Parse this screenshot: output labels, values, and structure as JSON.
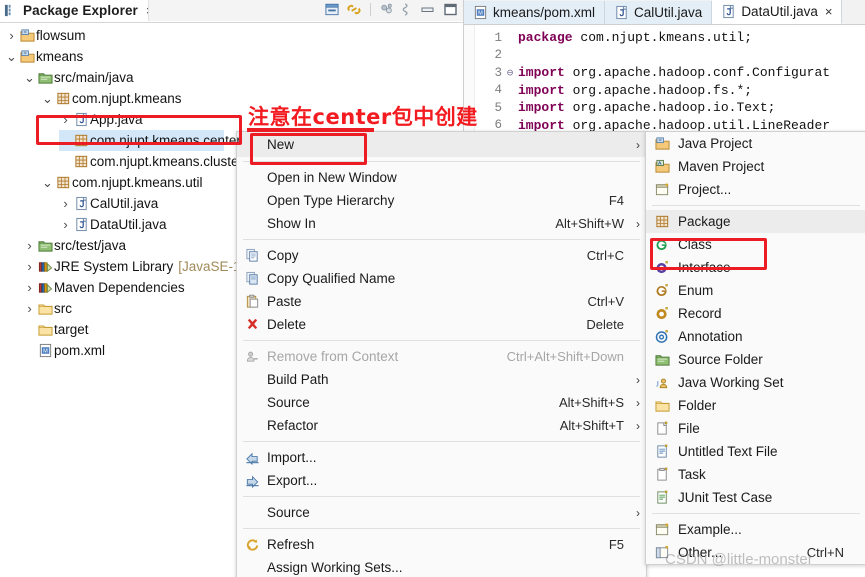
{
  "package_explorer": {
    "tab_title": "Package Explorer",
    "close_label": "×",
    "toolbar": [
      {
        "name": "collapse-all-icon",
        "title": "Collapse All"
      },
      {
        "name": "link-with-editor-icon",
        "title": "Link with Editor"
      },
      {
        "name": "view-menu-icon",
        "title": "View Menu"
      },
      {
        "name": "focus-on-active-task-icon",
        "title": "Focus on Active Task"
      },
      {
        "name": "minimize-icon",
        "title": "Minimize"
      },
      {
        "name": "maximize-icon",
        "title": "Maximize"
      }
    ],
    "tree": [
      {
        "label": "flowsum",
        "indent": 0,
        "twisty": "›",
        "icon": "java-project-icon",
        "selected": false
      },
      {
        "label": "kmeans",
        "indent": 0,
        "twisty": "⌄",
        "icon": "java-project-icon",
        "selected": false
      },
      {
        "label": "src/main/java",
        "indent": 1,
        "twisty": "⌄",
        "icon": "source-folder-icon",
        "selected": false
      },
      {
        "label": "com.njupt.kmeans",
        "indent": 2,
        "twisty": "⌄",
        "icon": "package-icon",
        "selected": false
      },
      {
        "label": "App.java",
        "indent": 3,
        "twisty": "›",
        "icon": "java-file-icon",
        "selected": false
      },
      {
        "label": "com.njupt.kmeans.center",
        "indent": 3,
        "twisty": "",
        "icon": "package-icon",
        "selected": true
      },
      {
        "label": "com.njupt.kmeans.cluster",
        "indent": 3,
        "twisty": "",
        "icon": "package-icon",
        "selected": false
      },
      {
        "label": "com.njupt.kmeans.util",
        "indent": 2,
        "twisty": "⌄",
        "icon": "package-icon",
        "selected": false
      },
      {
        "label": "CalUtil.java",
        "indent": 3,
        "twisty": "›",
        "icon": "java-file-icon",
        "selected": false
      },
      {
        "label": "DataUtil.java",
        "indent": 3,
        "twisty": "›",
        "icon": "java-file-icon",
        "selected": false
      },
      {
        "label": "src/test/java",
        "indent": 1,
        "twisty": "›",
        "icon": "source-folder-icon",
        "selected": false
      },
      {
        "label": "JRE System Library",
        "suffix": "[JavaSE-1",
        "indent": 1,
        "twisty": "›",
        "icon": "library-icon",
        "selected": false
      },
      {
        "label": "Maven Dependencies",
        "indent": 1,
        "twisty": "›",
        "icon": "library-icon",
        "selected": false
      },
      {
        "label": "src",
        "indent": 1,
        "twisty": "›",
        "icon": "folder-icon",
        "selected": false
      },
      {
        "label": "target",
        "indent": 1,
        "twisty": "",
        "icon": "folder-icon",
        "selected": false
      },
      {
        "label": "pom.xml",
        "indent": 1,
        "twisty": "",
        "icon": "xml-file-icon",
        "selected": false
      }
    ]
  },
  "editor": {
    "tabs": [
      {
        "label": "kmeans/pom.xml",
        "icon": "xml-file-icon",
        "active": false,
        "closable": false
      },
      {
        "label": "CalUtil.java",
        "icon": "java-file-icon",
        "active": false,
        "closable": false
      },
      {
        "label": "DataUtil.java",
        "icon": "java-file-icon",
        "active": true,
        "closable": true
      }
    ],
    "close_label": "×",
    "lines": [
      {
        "num": "1",
        "fold": "",
        "keyword": "package",
        "rest": " com.njupt.kmeans.util;"
      },
      {
        "num": "2",
        "fold": "",
        "keyword": "",
        "rest": ""
      },
      {
        "num": "3",
        "fold": "⊖",
        "keyword": "import",
        "rest": " org.apache.hadoop.conf.Configurat"
      },
      {
        "num": "4",
        "fold": "",
        "keyword": "import",
        "rest": " org.apache.hadoop.fs.*;"
      },
      {
        "num": "5",
        "fold": "",
        "keyword": "import",
        "rest": " org.apache.hadoop.io.Text;"
      },
      {
        "num": "6",
        "fold": "",
        "keyword": "import",
        "rest": " org.apache.hadoop.util.LineReader"
      }
    ]
  },
  "context_menu": {
    "items": [
      {
        "type": "item",
        "label": "New",
        "accel": "",
        "arrow": "›",
        "icon": "",
        "highlighted": true,
        "disabled": false
      },
      {
        "type": "separator"
      },
      {
        "type": "item",
        "label": "Open in New Window",
        "accel": "",
        "arrow": "",
        "icon": "",
        "highlighted": false,
        "disabled": false
      },
      {
        "type": "item",
        "label": "Open Type Hierarchy",
        "accel": "F4",
        "arrow": "",
        "icon": "",
        "highlighted": false,
        "disabled": false
      },
      {
        "type": "item",
        "label": "Show In",
        "accel": "Alt+Shift+W",
        "arrow": "›",
        "icon": "",
        "highlighted": false,
        "disabled": false
      },
      {
        "type": "separator"
      },
      {
        "type": "item",
        "label": "Copy",
        "accel": "Ctrl+C",
        "arrow": "",
        "icon": "copy-icon",
        "highlighted": false,
        "disabled": false
      },
      {
        "type": "item",
        "label": "Copy Qualified Name",
        "accel": "",
        "arrow": "",
        "icon": "copy-qualified-name-icon",
        "highlighted": false,
        "disabled": false
      },
      {
        "type": "item",
        "label": "Paste",
        "accel": "Ctrl+V",
        "arrow": "",
        "icon": "paste-icon",
        "highlighted": false,
        "disabled": false
      },
      {
        "type": "item",
        "label": "Delete",
        "accel": "Delete",
        "arrow": "",
        "icon": "delete-icon",
        "highlighted": false,
        "disabled": false
      },
      {
        "type": "separator"
      },
      {
        "type": "item",
        "label": "Remove from Context",
        "accel": "Ctrl+Alt+Shift+Down",
        "arrow": "",
        "icon": "remove-from-context-icon",
        "highlighted": false,
        "disabled": true
      },
      {
        "type": "item",
        "label": "Build Path",
        "accel": "",
        "arrow": "›",
        "icon": "",
        "highlighted": false,
        "disabled": false
      },
      {
        "type": "item",
        "label": "Source",
        "accel": "Alt+Shift+S",
        "arrow": "›",
        "icon": "",
        "highlighted": false,
        "disabled": false
      },
      {
        "type": "item",
        "label": "Refactor",
        "accel": "Alt+Shift+T",
        "arrow": "›",
        "icon": "",
        "highlighted": false,
        "disabled": false
      },
      {
        "type": "separator"
      },
      {
        "type": "item",
        "label": "Import...",
        "accel": "",
        "arrow": "",
        "icon": "import-icon",
        "highlighted": false,
        "disabled": false
      },
      {
        "type": "item",
        "label": "Export...",
        "accel": "",
        "arrow": "",
        "icon": "export-icon",
        "highlighted": false,
        "disabled": false
      },
      {
        "type": "separator"
      },
      {
        "type": "item",
        "label": "Source",
        "accel": "",
        "arrow": "›",
        "icon": "",
        "highlighted": false,
        "disabled": false
      },
      {
        "type": "separator"
      },
      {
        "type": "item",
        "label": "Refresh",
        "accel": "F5",
        "arrow": "",
        "icon": "refresh-icon",
        "highlighted": false,
        "disabled": false
      },
      {
        "type": "item",
        "label": "Assign Working Sets...",
        "accel": "",
        "arrow": "",
        "icon": "",
        "highlighted": false,
        "disabled": false
      }
    ]
  },
  "new_submenu": {
    "items": [
      {
        "type": "item",
        "label": "Java Project",
        "accel": "",
        "icon": "java-project-icon",
        "highlighted": false
      },
      {
        "type": "item",
        "label": "Maven Project",
        "accel": "",
        "icon": "maven-project-icon",
        "highlighted": false
      },
      {
        "type": "item",
        "label": "Project...",
        "accel": "",
        "icon": "project-icon",
        "highlighted": false
      },
      {
        "type": "separator"
      },
      {
        "type": "item",
        "label": "Package",
        "accel": "",
        "icon": "package-icon",
        "highlighted": true
      },
      {
        "type": "item",
        "label": "Class",
        "accel": "",
        "icon": "class-icon",
        "highlighted": false
      },
      {
        "type": "item",
        "label": "Interface",
        "accel": "",
        "icon": "interface-icon",
        "highlighted": false
      },
      {
        "type": "item",
        "label": "Enum",
        "accel": "",
        "icon": "enum-icon",
        "highlighted": false
      },
      {
        "type": "item",
        "label": "Record",
        "accel": "",
        "icon": "record-icon",
        "highlighted": false
      },
      {
        "type": "item",
        "label": "Annotation",
        "accel": "",
        "icon": "annotation-icon",
        "highlighted": false
      },
      {
        "type": "item",
        "label": "Source Folder",
        "accel": "",
        "icon": "source-folder-icon",
        "highlighted": false
      },
      {
        "type": "item",
        "label": "Java Working Set",
        "accel": "",
        "icon": "java-working-set-icon",
        "highlighted": false
      },
      {
        "type": "item",
        "label": "Folder",
        "accel": "",
        "icon": "folder-icon",
        "highlighted": false
      },
      {
        "type": "item",
        "label": "File",
        "accel": "",
        "icon": "file-icon",
        "highlighted": false
      },
      {
        "type": "item",
        "label": "Untitled Text File",
        "accel": "",
        "icon": "text-file-icon",
        "highlighted": false
      },
      {
        "type": "item",
        "label": "Task",
        "accel": "",
        "icon": "task-icon",
        "highlighted": false
      },
      {
        "type": "item",
        "label": "JUnit Test Case",
        "accel": "",
        "icon": "junit-test-case-icon",
        "highlighted": false
      },
      {
        "type": "separator"
      },
      {
        "type": "item",
        "label": "Example...",
        "accel": "",
        "icon": "example-icon",
        "highlighted": false
      },
      {
        "type": "item",
        "label": "Other...",
        "accel": "Ctrl+N",
        "icon": "other-icon",
        "highlighted": false
      }
    ]
  },
  "annotations": {
    "note_text": "注意在center包中创建",
    "note_color": "#f31b20",
    "box_color": "#ec1c24",
    "watermark": "CSDN @little-monster"
  },
  "colors": {
    "selection": "#d3e7f9",
    "menu_bg": "#fafafa",
    "menu_highlight": "#ececec",
    "keyword": "#7f0055"
  }
}
